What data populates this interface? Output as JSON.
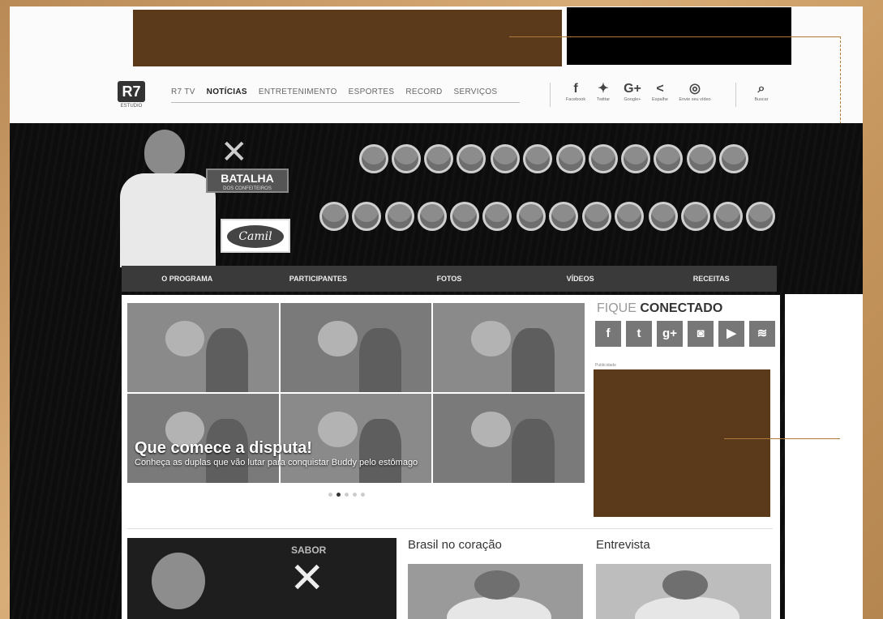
{
  "topnav": {
    "logo": "R7",
    "logo_sub": "ESTUDIO",
    "links": [
      "R7 TV",
      "NOTÍCIAS",
      "ENTRETENIMENTO",
      "ESPORTES",
      "RECORD",
      "SERVIÇOS"
    ],
    "active_index": 1,
    "tools": [
      {
        "icon": "facebook-icon",
        "glyph": "f",
        "label": "Facebook"
      },
      {
        "icon": "twitter-icon",
        "glyph": "🐦",
        "label": "Twittar"
      },
      {
        "icon": "googleplus-icon",
        "glyph": "G+",
        "label": "Google+"
      },
      {
        "icon": "share-icon",
        "glyph": "<",
        "label": "Espalhe"
      },
      {
        "icon": "video-icon",
        "glyph": "◎",
        "label": "Envie seu vídeo"
      },
      {
        "icon": "search-icon",
        "glyph": "⌕",
        "label": "Buscar"
      }
    ]
  },
  "hero": {
    "show_title": "BATALHA",
    "show_subtitle": "DOS CONFEITEIROS",
    "sponsor": "Camil"
  },
  "section_nav": [
    "O PROGRAMA",
    "PARTICIPANTES",
    "FOTOS",
    "VÍDEOS",
    "RECEITAS"
  ],
  "slider": {
    "headline": "Que comece a disputa!",
    "subline": "Conheça as duplas que vão lutar para conquistar Buddy pelo estômago",
    "dots": 5,
    "active_dot": 1
  },
  "sidebar": {
    "fique_light": "FIQUE ",
    "fique_bold": "CONECTADO",
    "social": [
      {
        "icon": "facebook-icon",
        "glyph": "f"
      },
      {
        "icon": "twitter-icon",
        "glyph": "t"
      },
      {
        "icon": "googleplus-icon",
        "glyph": "g+"
      },
      {
        "icon": "instagram-icon",
        "glyph": "◙"
      },
      {
        "icon": "youtube-icon",
        "glyph": "▶"
      },
      {
        "icon": "rss-icon",
        "glyph": "≋"
      }
    ],
    "pub_label": "Publicidade"
  },
  "cards": [
    {
      "title": "",
      "badge": "SABOR"
    },
    {
      "title": "Brasil no coração"
    },
    {
      "title": "Entrevista"
    }
  ]
}
